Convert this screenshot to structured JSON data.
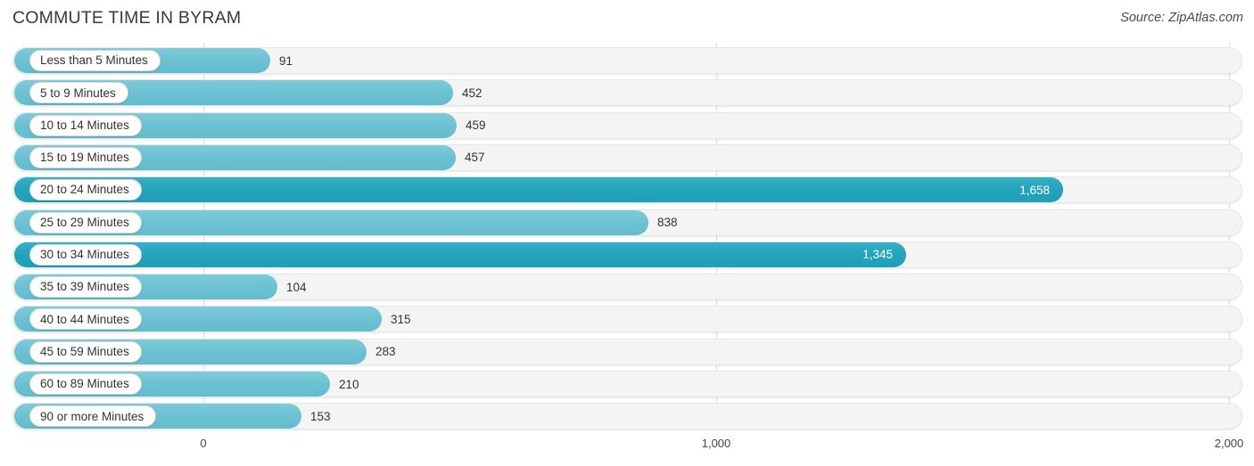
{
  "header": {
    "title": "COMMUTE TIME IN BYRAM",
    "source": "Source: ZipAtlas.com"
  },
  "chart_data": {
    "type": "bar",
    "orientation": "horizontal",
    "title": "COMMUTE TIME IN BYRAM",
    "subtitle": "Source: ZipAtlas.com",
    "xlabel": "",
    "ylabel": "",
    "xlim": [
      0,
      2000
    ],
    "grid": true,
    "legend": false,
    "axis_ticks": [
      "0",
      "1,000",
      "2,000"
    ],
    "axis_tick_values": [
      0,
      1000,
      2000
    ],
    "categories": [
      "Less than 5 Minutes",
      "5 to 9 Minutes",
      "10 to 14 Minutes",
      "15 to 19 Minutes",
      "20 to 24 Minutes",
      "25 to 29 Minutes",
      "30 to 34 Minutes",
      "35 to 39 Minutes",
      "40 to 44 Minutes",
      "45 to 59 Minutes",
      "60 to 89 Minutes",
      "90 or more Minutes"
    ],
    "values": [
      91,
      452,
      459,
      457,
      1658,
      838,
      1345,
      104,
      315,
      283,
      210,
      153
    ],
    "value_labels": [
      "91",
      "452",
      "459",
      "457",
      "1,658",
      "838",
      "1,345",
      "104",
      "315",
      "283",
      "210",
      "153"
    ],
    "colors": {
      "bar_light": "#6cc2d2",
      "bar_dark": "#25a4bb",
      "track": "#f4f4f4",
      "gridline": "#dcdcdc"
    }
  },
  "rows": [
    {
      "label": "Less than 5 Minutes",
      "value_label": "91",
      "bar_end": 303,
      "tone": "light",
      "inside": false
    },
    {
      "label": "5 to 9 Minutes",
      "value_label": "452",
      "bar_end": 508,
      "tone": "light",
      "inside": false
    },
    {
      "label": "10 to 14 Minutes",
      "value_label": "459",
      "bar_end": 512,
      "tone": "light",
      "inside": false
    },
    {
      "label": "15 to 19 Minutes",
      "value_label": "457",
      "bar_end": 511,
      "tone": "light",
      "inside": false
    },
    {
      "label": "20 to 24 Minutes",
      "value_label": "1,658",
      "bar_end": 1192,
      "tone": "dark",
      "inside": true
    },
    {
      "label": "25 to 29 Minutes",
      "value_label": "838",
      "bar_end": 727,
      "tone": "light",
      "inside": false
    },
    {
      "label": "30 to 34 Minutes",
      "value_label": "1,345",
      "bar_end": 1016,
      "tone": "dark",
      "inside": true
    },
    {
      "label": "35 to 39 Minutes",
      "value_label": "104",
      "bar_end": 311,
      "tone": "light",
      "inside": false
    },
    {
      "label": "40 to 44 Minutes",
      "value_label": "315",
      "bar_end": 428,
      "tone": "light",
      "inside": false
    },
    {
      "label": "45 to 59 Minutes",
      "value_label": "283",
      "bar_end": 411,
      "tone": "light",
      "inside": false
    },
    {
      "label": "60 to 89 Minutes",
      "value_label": "210",
      "bar_end": 370,
      "tone": "light",
      "inside": false
    },
    {
      "label": "90 or more Minutes",
      "value_label": "153",
      "bar_end": 338,
      "tone": "light",
      "inside": false
    }
  ],
  "axis": {
    "ticks": [
      {
        "label": "0",
        "x": 228
      },
      {
        "label": "1,000",
        "x": 803
      },
      {
        "label": "2,000",
        "x": 1378
      }
    ]
  }
}
